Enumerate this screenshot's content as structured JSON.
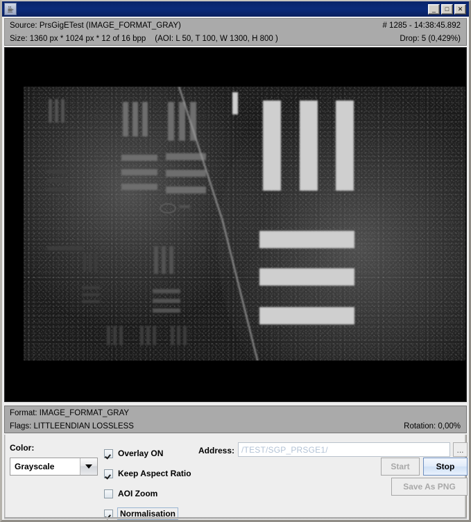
{
  "window": {
    "icon": "java-coffee-cup-icon",
    "title": "",
    "minimize_label": "_",
    "maximize_label": "□",
    "close_label": "✕"
  },
  "top_info": {
    "source": "Source: PrsGigETest (IMAGE_FORMAT_GRAY)",
    "frame_counter": "# 1285 - 14:38:45.892",
    "size": "Size: 1360 px * 1024 px * 12 of 16 bpp",
    "aoi": "(AOI: L 50, T 100, W 1300, H 800 )",
    "drop": "Drop: 5 (0,429%)"
  },
  "image_view": {
    "alt": "USAF 1951 resolution test target, noisy grayscale capture"
  },
  "status_info": {
    "format": "Format: IMAGE_FORMAT_GRAY",
    "flags": "Flags: LITTLEENDIAN LOSSLESS",
    "rotation": "Rotation: 0,00%"
  },
  "controls": {
    "color_label": "Color:",
    "color_value": "Grayscale",
    "color_options": [
      "Grayscale"
    ],
    "checkboxes": [
      {
        "label": "Overlay ON",
        "checked": true,
        "focused": false
      },
      {
        "label": "Keep Aspect Ratio",
        "checked": true,
        "focused": false
      },
      {
        "label": "AOI Zoom",
        "checked": false,
        "focused": false
      },
      {
        "label": "Normalisation",
        "checked": true,
        "focused": true
      }
    ],
    "address_label": "Address:",
    "address_value": "/TEST/SGP_PRSGE1/",
    "address_placeholder": "/TEST/SGP_PRSGE1/",
    "browse_label": "...",
    "start_label": "Start",
    "start_enabled": false,
    "stop_label": "Stop",
    "stop_enabled": true,
    "save_png_label": "Save As PNG",
    "save_png_enabled": false
  },
  "colors": {
    "titlebar": "#0a246a",
    "info_panel": "#aaaaaa",
    "panel_bg": "#eeeeee",
    "image_bg": "#000000",
    "accent_button": "#cfe0f5"
  }
}
